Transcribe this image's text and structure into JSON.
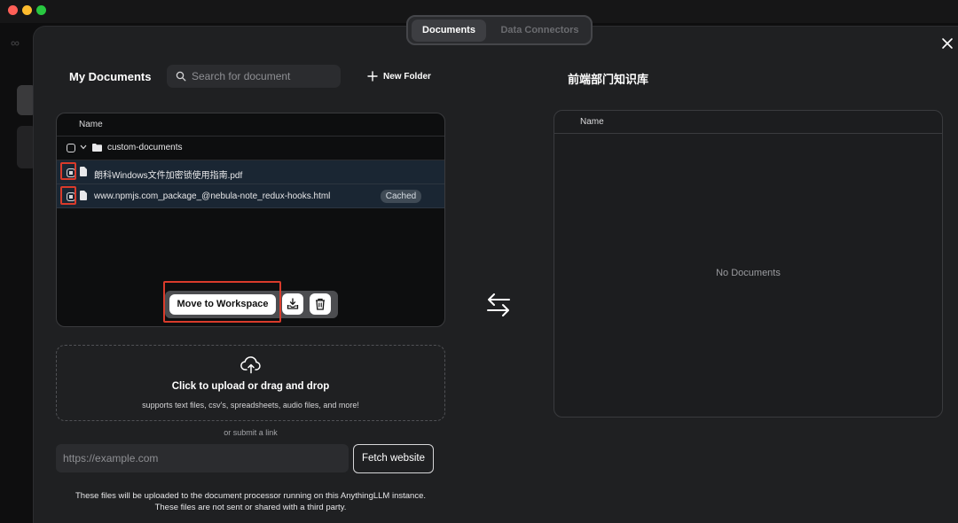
{
  "window": {
    "controls": [
      "close",
      "minimize",
      "maximize"
    ]
  },
  "tabs": {
    "documents": "Documents",
    "data_connectors": "Data Connectors"
  },
  "left": {
    "title": "My Documents",
    "search_placeholder": "Search for document",
    "new_folder": "New Folder",
    "column_name": "Name",
    "folder": "custom-documents",
    "files": [
      {
        "name": "朗科Windows文件加密锁使用指南.pdf",
        "selected": true
      },
      {
        "name": "www.npmjs.com_package_@nebula-note_redux-hooks.html",
        "selected": true,
        "badge": "Cached"
      }
    ],
    "move_button": "Move to Workspace"
  },
  "right": {
    "title": "前端部门知识库",
    "column_name": "Name",
    "empty": "No Documents"
  },
  "upload": {
    "title": "Click to upload or drag and drop",
    "subtitle": "supports text files, csv's, spreadsheets, audio files, and more!",
    "or_link": "or submit a link",
    "url_placeholder": "https://example.com",
    "fetch_button": "Fetch website",
    "footnote_1": "These files will be uploaded to the document processor running on this AnythingLLM instance.",
    "footnote_2": "These files are not sent or shared with a third party."
  },
  "colors": {
    "highlight": "#d93b2b",
    "selected_row": "#1a2633"
  }
}
